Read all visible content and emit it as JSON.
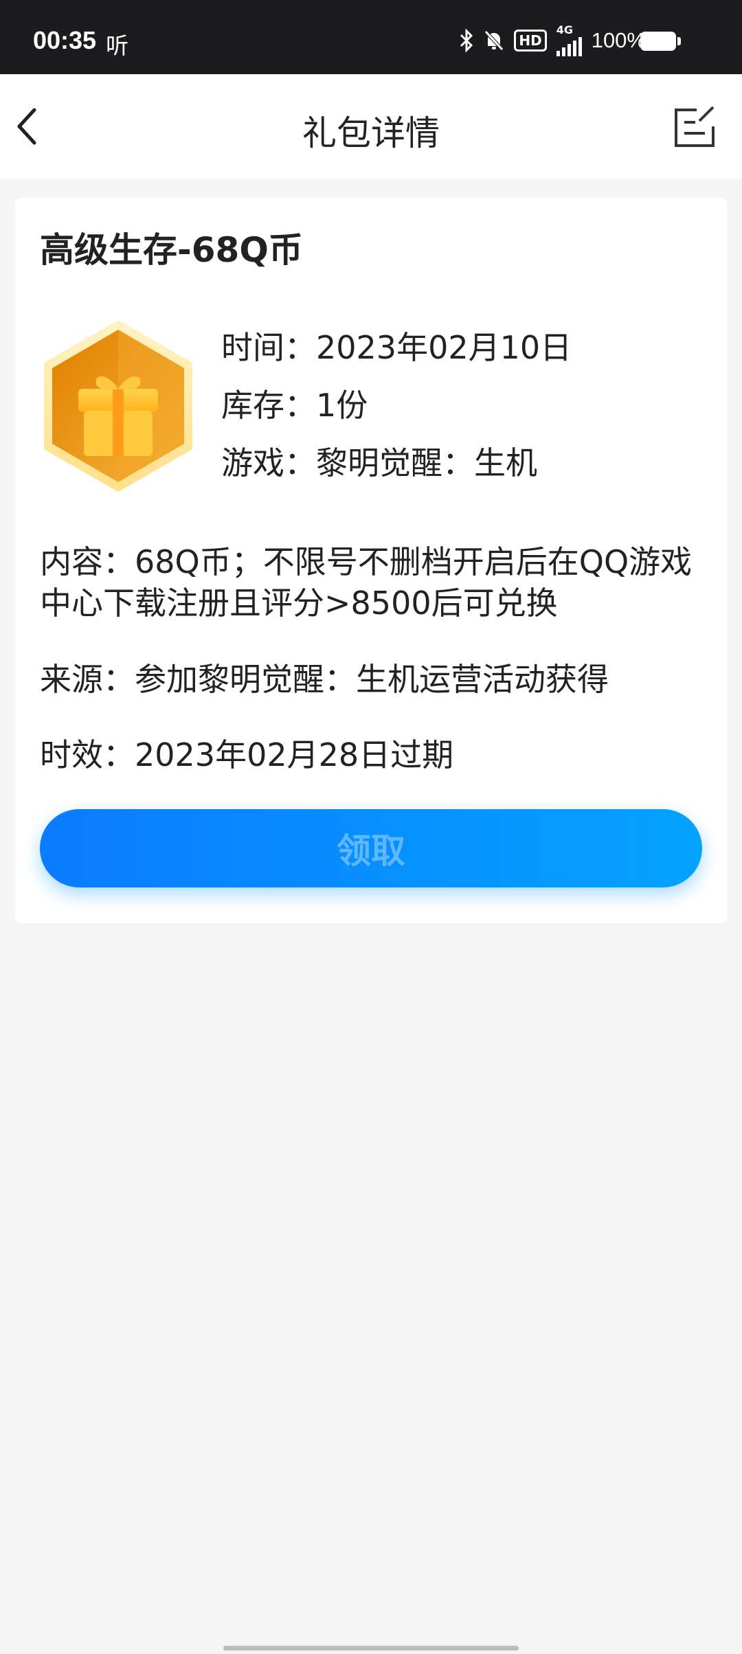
{
  "status_bar": {
    "time": "00:35",
    "listen_label": "听",
    "network_label": "4G",
    "hd_label": "HD",
    "battery_label": "100%",
    "icons": [
      "bluetooth-icon",
      "mute-icon",
      "hd-icon",
      "signal-icon",
      "battery-icon"
    ]
  },
  "nav": {
    "title": "礼包详情",
    "back_icon": "chevron-left-icon",
    "edit_icon": "edit-note-icon"
  },
  "gift": {
    "title": "高级生存-68Q币",
    "badge_icon": "gift-box-icon",
    "time": "时间：2023年02月10日",
    "stock": "库存：1份",
    "game": "游戏：黎明觉醒：生机",
    "content": "内容：68Q币；不限号不删档开启后在QQ游戏中心下载注册且评分>8500后可兑换",
    "source": "来源：参加黎明觉醒：生机运营活动获得",
    "expiry": "时效：2023年02月28日过期",
    "claim_label": "领取"
  },
  "colors": {
    "accent_start": "#0a7cff",
    "accent_end": "#05a2ff",
    "badge_orange": "#f0a21b",
    "page_bg": "#f5f5f5"
  }
}
